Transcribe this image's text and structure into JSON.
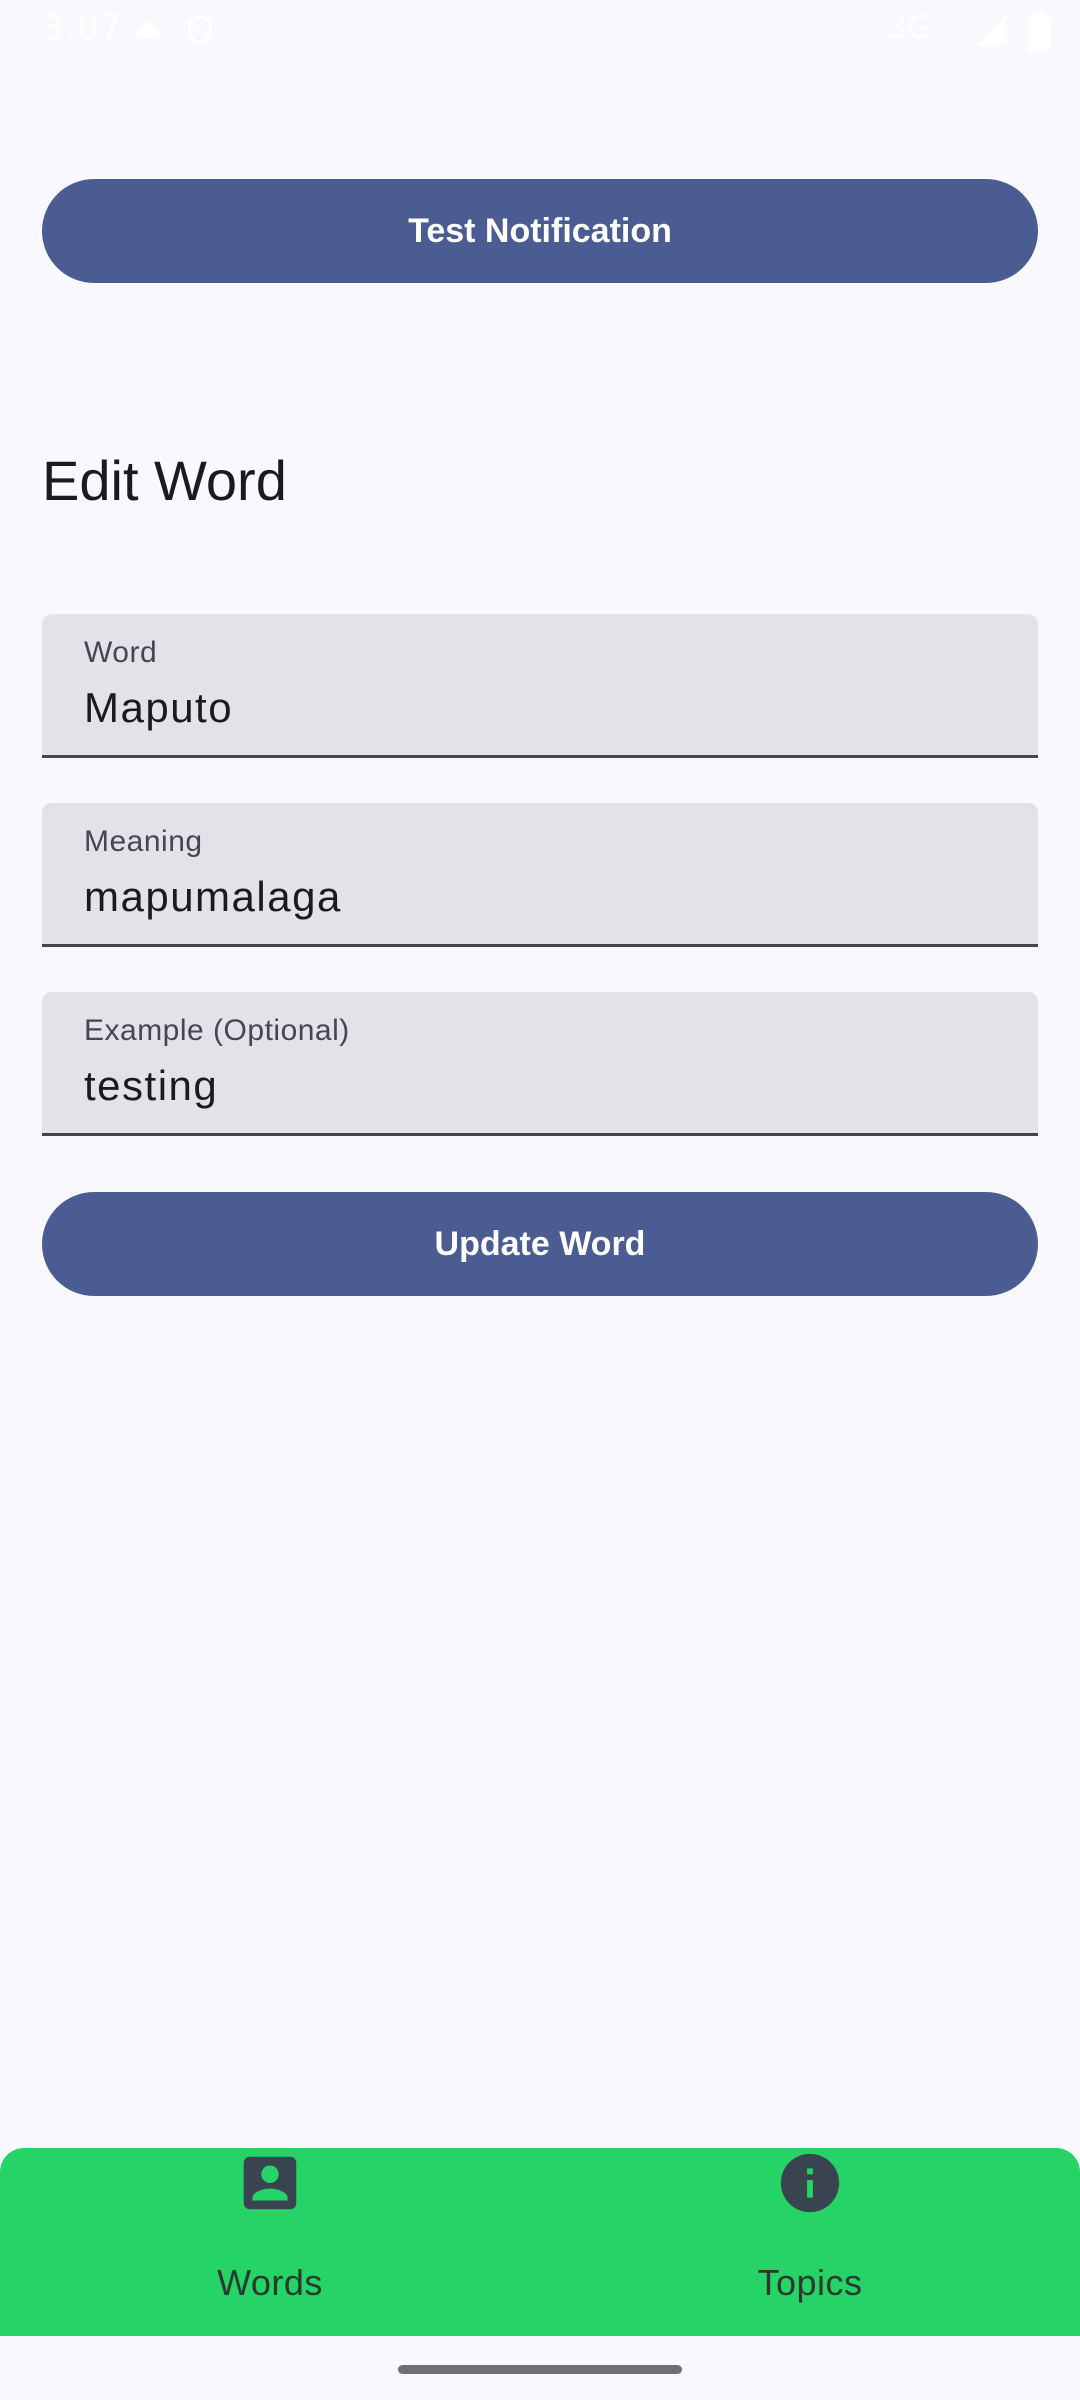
{
  "status_bar": {
    "time": "3:07",
    "network": "3G",
    "icons": [
      "cloud-icon",
      "vpn-shield-icon",
      "signal-icon",
      "battery-icon"
    ]
  },
  "actions": {
    "test_notification_label": "Test Notification",
    "update_word_label": "Update Word"
  },
  "page": {
    "title": "Edit Word"
  },
  "form": {
    "word": {
      "label": "Word",
      "value": "Maputo"
    },
    "meaning": {
      "label": "Meaning",
      "value": "mapumalaga"
    },
    "example": {
      "label": "Example (Optional)",
      "value": "testing"
    }
  },
  "bottom_nav": {
    "items": [
      {
        "label": "Words",
        "icon": "account-box-icon"
      },
      {
        "label": "Topics",
        "icon": "info-icon"
      }
    ]
  },
  "colors": {
    "background": "#F8F8FD",
    "primary_button": "#4A5C92",
    "field_background": "#E3E2E8",
    "bottom_nav": "#25D366"
  }
}
